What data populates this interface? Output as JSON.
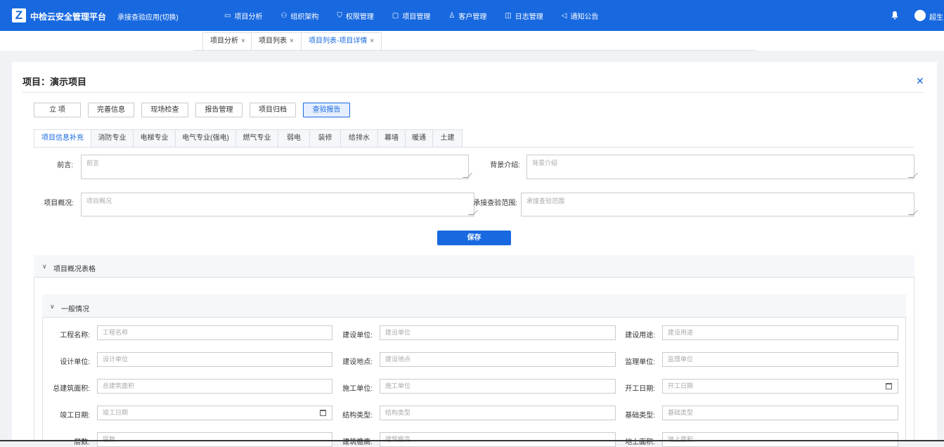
{
  "header": {
    "logo_letter": "Z",
    "brand": "中检云安全管理平台",
    "switch_label": "承接查验应用(切换)",
    "nav": [
      {
        "label": "项目分析",
        "icon": "analysis-icon"
      },
      {
        "label": "组织架构",
        "icon": "org-icon"
      },
      {
        "label": "权限管理",
        "icon": "shield-icon"
      },
      {
        "label": "项目管理",
        "icon": "folder-icon"
      },
      {
        "label": "客户管理",
        "icon": "user-icon"
      },
      {
        "label": "日志管理",
        "icon": "book-icon"
      },
      {
        "label": "通知公告",
        "icon": "megaphone-icon"
      }
    ],
    "user_name": "超生"
  },
  "page_tabs": [
    {
      "label": "项目分析",
      "active": false
    },
    {
      "label": "项目列表",
      "active": false
    },
    {
      "label": "项目列表-项目详情",
      "active": true
    }
  ],
  "project_title": "项目：演示项目",
  "action_buttons": [
    {
      "label": "立 项",
      "active": false
    },
    {
      "label": "完善信息",
      "active": false
    },
    {
      "label": "现场检查",
      "active": false
    },
    {
      "label": "报告管理",
      "active": false
    },
    {
      "label": "项目归档",
      "active": false
    },
    {
      "label": "查验报告",
      "active": true
    }
  ],
  "sub_tabs": [
    {
      "label": "项目信息补充",
      "active": true
    },
    {
      "label": "消防专业"
    },
    {
      "label": "电梯专业"
    },
    {
      "label": "电气专业(强电)"
    },
    {
      "label": "燃气专业"
    },
    {
      "label": "弱电"
    },
    {
      "label": "装修"
    },
    {
      "label": "给排水"
    },
    {
      "label": "幕墙"
    },
    {
      "label": "暖通"
    },
    {
      "label": "土建"
    }
  ],
  "textareas": {
    "preface": {
      "label": "前言:",
      "placeholder": "前言"
    },
    "background": {
      "label": "背景介绍:",
      "placeholder": "背景介绍"
    },
    "overview": {
      "label": "项目概况:",
      "placeholder": "项目概况"
    },
    "scope": {
      "label": "承接查验范围:",
      "placeholder": "承接查验范围"
    }
  },
  "save_label": "保存",
  "section1_title": "项目概况表格",
  "section2_title": "一般情况",
  "fields": [
    {
      "label": "工程名称:",
      "placeholder": "工程名称"
    },
    {
      "label": "建设单位:",
      "placeholder": "建设单位"
    },
    {
      "label": "建设用途:",
      "placeholder": "建设用途"
    },
    {
      "label": "设计单位:",
      "placeholder": "设计单位"
    },
    {
      "label": "建设地点:",
      "placeholder": "建设地点"
    },
    {
      "label": "监理单位:",
      "placeholder": "监理单位"
    },
    {
      "label": "总建筑面积:",
      "placeholder": "总建筑面积"
    },
    {
      "label": "施工单位:",
      "placeholder": "施工单位"
    },
    {
      "label": "开工日期:",
      "placeholder": "开工日期"
    },
    {
      "label": "竣工日期:",
      "placeholder": "竣工日期"
    },
    {
      "label": "结构类型:",
      "placeholder": "结构类型"
    },
    {
      "label": "基础类型:",
      "placeholder": "基础类型"
    },
    {
      "label": "层数:",
      "placeholder": "层数"
    },
    {
      "label": "建筑檐高:",
      "placeholder": "建筑檐高"
    },
    {
      "label": "地上面积:",
      "placeholder": "地上面积"
    }
  ]
}
